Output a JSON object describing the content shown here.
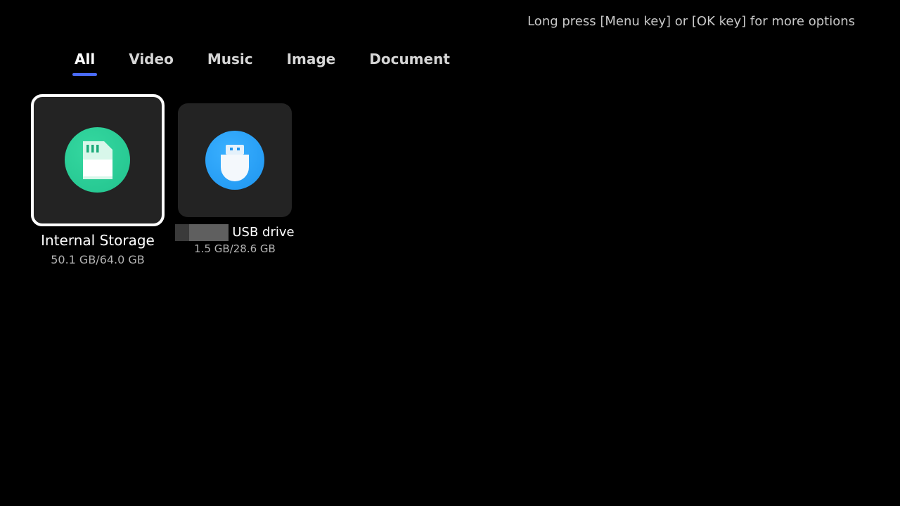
{
  "header": {
    "hint": "Long press [Menu key] or [OK key] for more options"
  },
  "tabs": [
    {
      "label": "All",
      "active": true
    },
    {
      "label": "Video",
      "active": false
    },
    {
      "label": "Music",
      "active": false
    },
    {
      "label": "Image",
      "active": false
    },
    {
      "label": "Document",
      "active": false
    }
  ],
  "colors": {
    "accent": "#4a6cf7",
    "internal_storage": "#22c38e",
    "usb_drive": "#1e95f0"
  },
  "devices": [
    {
      "name": "Internal Storage",
      "size": "50.1 GB/64.0 GB",
      "icon": "sd-card-icon",
      "focused": true
    },
    {
      "name": "USB drive",
      "size": "1.5 GB/28.6 GB",
      "icon": "usb-drive-icon",
      "focused": false
    }
  ]
}
